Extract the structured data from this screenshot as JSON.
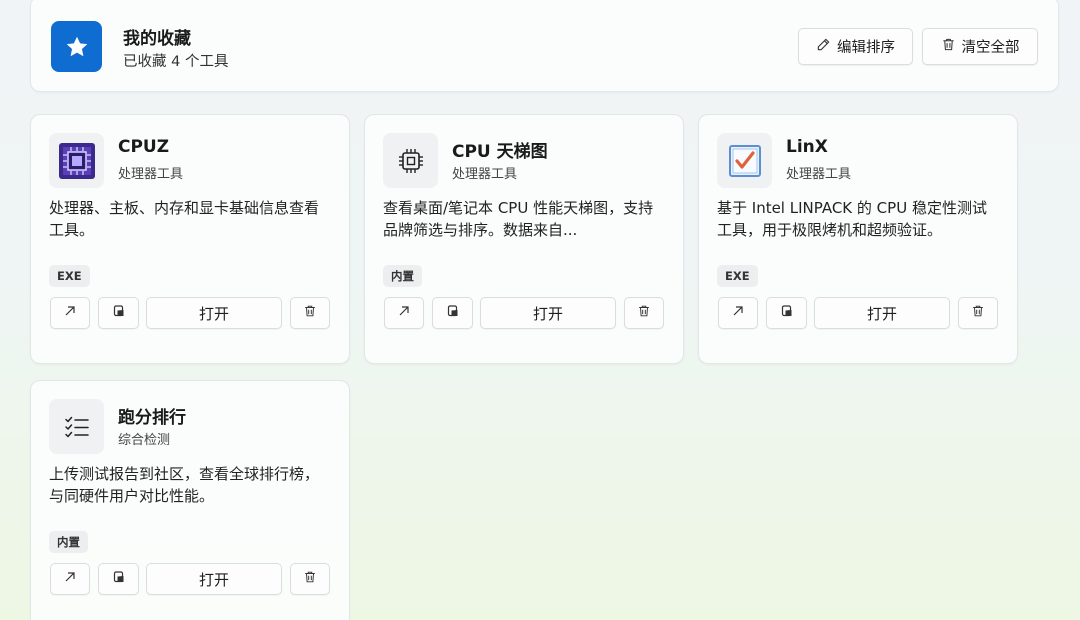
{
  "header": {
    "title": "我的收藏",
    "subtitle": "已收藏 4 个工具",
    "edit_label": "编辑排序",
    "clear_label": "清空全部",
    "icon": "star-icon",
    "accent": "#0f6cd0"
  },
  "cards": [
    {
      "name": "CPUZ",
      "category": "处理器工具",
      "description": "处理器、主板、内存和显卡基础信息查看工具。",
      "tag": "EXE",
      "icon": "cpuz-app-icon",
      "open_label": "打开"
    },
    {
      "name": "CPU 天梯图",
      "category": "处理器工具",
      "description": "查看桌面/笔记本 CPU 性能天梯图，支持品牌筛选与排序。数据来自...",
      "tag": "内置",
      "icon": "cpu-chip-icon",
      "open_label": "打开"
    },
    {
      "name": "LinX",
      "category": "处理器工具",
      "description": "基于 Intel LINPACK 的 CPU 稳定性测试工具，用于极限烤机和超频验证。",
      "tag": "EXE",
      "icon": "checkbox-app-icon",
      "open_label": "打开"
    },
    {
      "name": "跑分排行",
      "category": "综合检测",
      "description": "上传测试报告到社区，查看全球排行榜，与同硬件用户对比性能。",
      "tag": "内置",
      "icon": "ranking-list-icon",
      "open_label": "打开"
    }
  ]
}
